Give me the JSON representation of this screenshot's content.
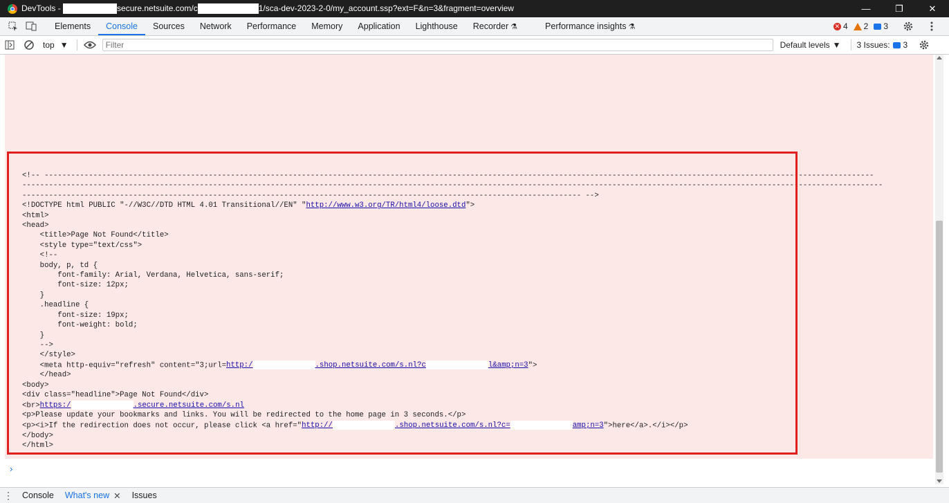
{
  "window": {
    "title_prefix": "DevTools - ",
    "title_mid": "secure.netsuite.com/c",
    "title_suffix": "1/sca-dev-2023-2-0/my_account.ssp?ext=F&n=3&fragment=overview",
    "minimize": "—",
    "restore": "❐",
    "close": "✕"
  },
  "tabs": [
    "Elements",
    "Console",
    "Sources",
    "Network",
    "Performance",
    "Memory",
    "Application",
    "Lighthouse",
    "Recorder",
    "Performance insights"
  ],
  "counters": {
    "errors": "4",
    "warnings": "2",
    "messages": "3"
  },
  "toolbar": {
    "context": "top",
    "filter_placeholder": "Filter",
    "levels": "Default levels",
    "issues_label": "3 Issues:",
    "issues_count": "3"
  },
  "code": {
    "l1": "<!-- -------------------------------------------------------------------------------------------------------------------------------------------------------------------------------------------",
    "l2": "--------------------------------------------------------------------------------------------------------------------------------------------------------------------------------------------------",
    "l3": "------------------------------------------------------------------------------------------------------------------------------ -->",
    "l4a": "<!DOCTYPE html PUBLIC \"-//W3C//DTD HTML 4.01 Transitional//EN\" \"",
    "l4link": "http://www.w3.org/TR/html4/loose.dtd",
    "l4b": "\">",
    "l5": "<html>",
    "l6": "<head>",
    "l7": "    <title>Page Not Found</title>",
    "l8": "    <style type=\"text/css\">",
    "l9": "    <!--",
    "l10": "    body, p, td {",
    "l11": "        font-family: Arial, Verdana, Helvetica, sans-serif;",
    "l12": "        font-size: 12px;",
    "l13": "    }",
    "l14": "    .headline {",
    "l15": "        font-size: 19px;",
    "l16": "        font-weight: bold;",
    "l17": "    }",
    "l18": "    -->",
    "l19": "    </style>",
    "l20a": "    <meta http-equiv=\"refresh\" content=\"3;url=",
    "l20link1": "http:/",
    "l20link2": ".shop.netsuite.com/s.nl?c",
    "l20link3": "l&amp;n=3",
    "l20b": "\">",
    "l21": "    </head>",
    "l22": "<body>",
    "l23": "<div class=\"headline\">Page Not Found</div>",
    "l24a": "<br>",
    "l24link1": "https:/",
    "l24link2": ".secure.netsuite.com/s.nl",
    "l25": "<p>Please update your bookmarks and links. You will be redirected to the home page in 3 seconds.</p>",
    "l26a": "<p><i>If the redirection does not occur, please click <a href=\"",
    "l26link1": "http://",
    "l26link2": ".shop.netsuite.com/s.nl?c=",
    "l26link3": "amp;n=3",
    "l26b": "\">here</a>.</i></p>",
    "l27": "</body>",
    "l28": "</html>"
  },
  "prompt": "›",
  "drawer": {
    "console": "Console",
    "whats_new": "What's new",
    "issues": "Issues",
    "close": "✕"
  }
}
